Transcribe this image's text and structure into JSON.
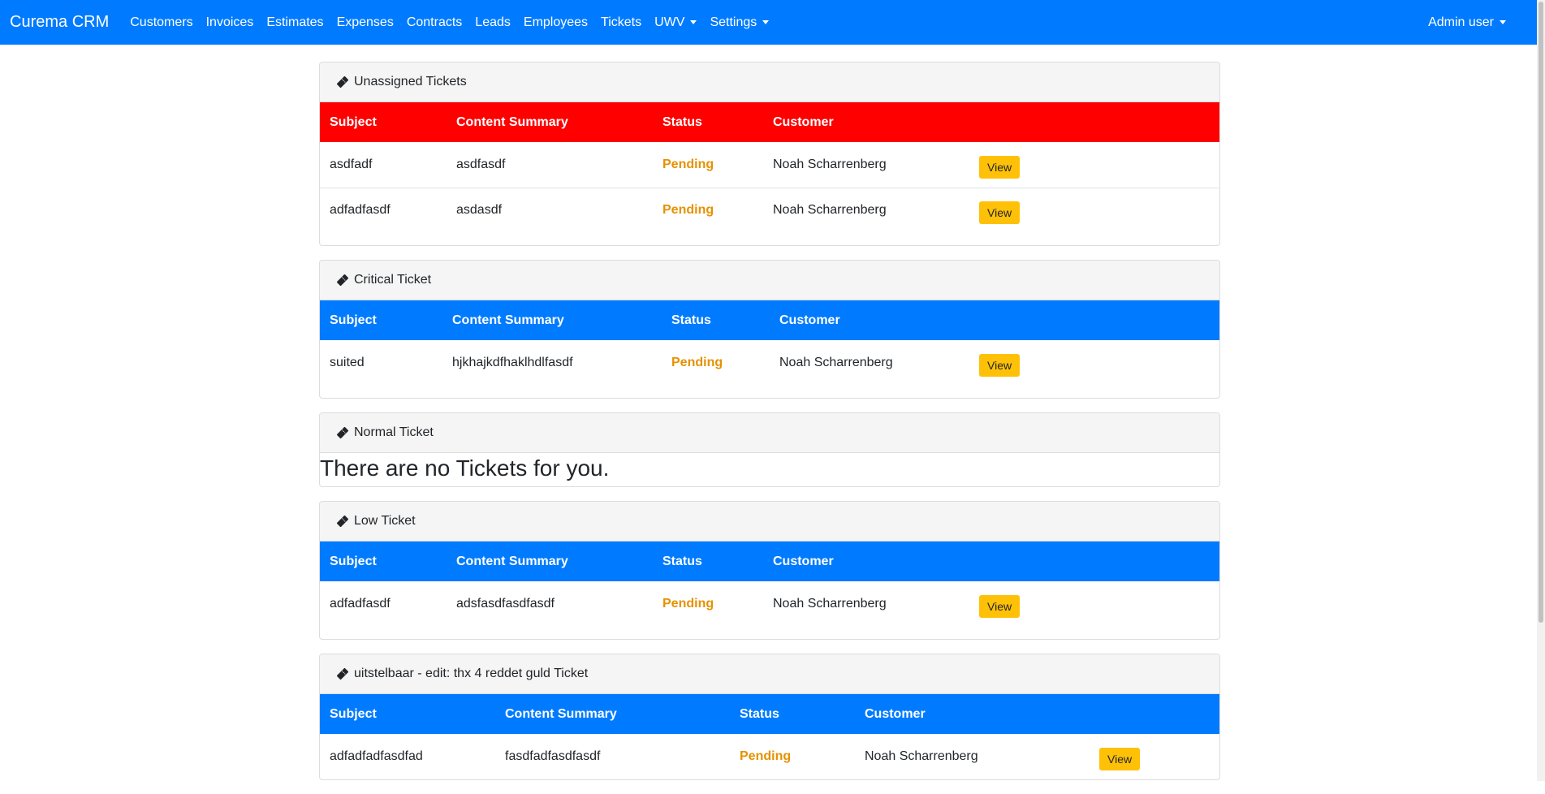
{
  "navbar": {
    "brand": "Curema CRM",
    "items": [
      {
        "label": "Customers"
      },
      {
        "label": "Invoices"
      },
      {
        "label": "Estimates"
      },
      {
        "label": "Expenses"
      },
      {
        "label": "Contracts"
      },
      {
        "label": "Leads"
      },
      {
        "label": "Employees"
      },
      {
        "label": "Tickets"
      },
      {
        "label": "UWV"
      },
      {
        "label": "Settings"
      }
    ],
    "user": "Admin user"
  },
  "colors": {
    "navbar": "#007bff",
    "unassigned_header": "#ff0000",
    "table_header": "#007bff",
    "status_pending": "#e69100",
    "view_button": "#ffc107"
  },
  "columns": {
    "subject": "Subject",
    "content": "Content Summary",
    "status": "Status",
    "customer": "Customer"
  },
  "view_label": "View",
  "sections": {
    "unassigned": {
      "title": "Unassigned Tickets",
      "rows": [
        {
          "subject": "asdfadf",
          "content": "asdfasdf",
          "status": "Pending",
          "customer": "Noah Scharrenberg"
        },
        {
          "subject": "adfadfasdf",
          "content": "asdasdf",
          "status": "Pending",
          "customer": "Noah Scharrenberg"
        }
      ]
    },
    "critical": {
      "title": "Critical Ticket",
      "rows": [
        {
          "subject": "suited",
          "content": "hjkhajkdfhaklhdlfasdf",
          "status": "Pending",
          "customer": "Noah Scharrenberg"
        }
      ]
    },
    "normal": {
      "title": "Normal Ticket",
      "empty_message": "There are no Tickets for you."
    },
    "low": {
      "title": "Low Ticket",
      "rows": [
        {
          "subject": "adfadfasdf",
          "content": "adsfasdfasdfasdf",
          "status": "Pending",
          "customer": "Noah Scharrenberg"
        }
      ]
    },
    "postponed": {
      "title": "uitstelbaar - edit: thx 4 reddet guld Ticket",
      "rows": [
        {
          "subject": "adfadfadfasdfad",
          "content": "fasdfadfasdfasdf",
          "status": "Pending",
          "customer": "Noah Scharrenberg"
        }
      ]
    }
  }
}
